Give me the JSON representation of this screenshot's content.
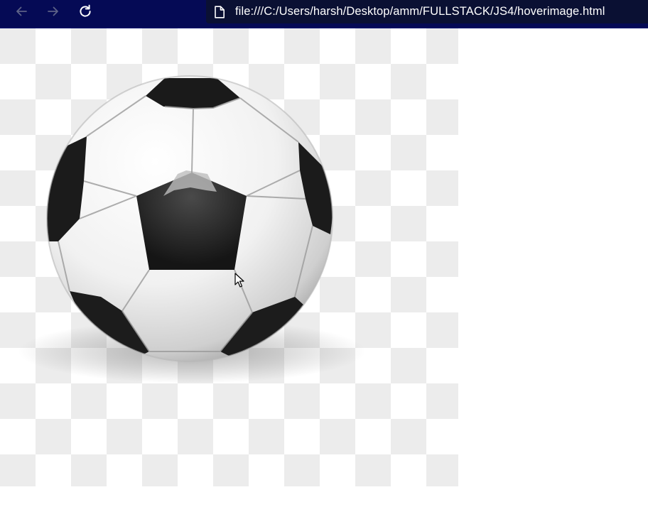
{
  "browser": {
    "address_bar": {
      "url": "file:///C:/Users/harsh/Desktop/amm/FULLSTACK/JS4/hoverimage.html"
    },
    "nav": {
      "back_icon": "arrow-left-icon",
      "forward_icon": "arrow-right-icon",
      "reload_icon": "reload-icon",
      "back_enabled": false,
      "forward_enabled": false
    },
    "colors": {
      "toolbar": "#050a55",
      "address_bar": "#0a1033"
    }
  },
  "page": {
    "image": {
      "subject": "soccer-ball",
      "background": "transparency-checkerboard"
    }
  }
}
